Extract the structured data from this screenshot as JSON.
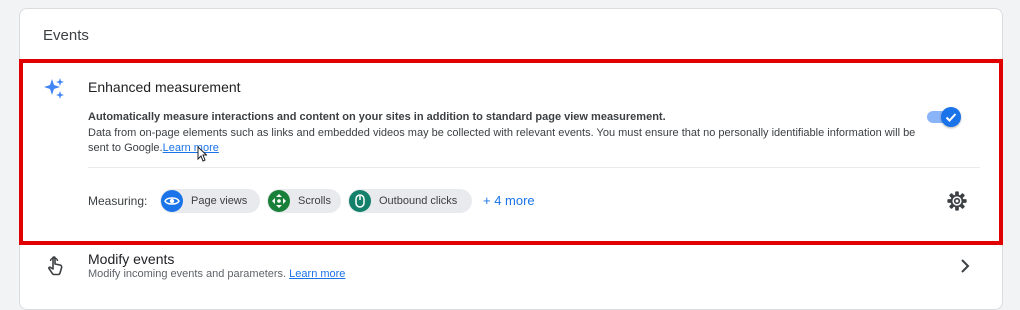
{
  "section": {
    "title": "Events"
  },
  "enhanced": {
    "title": "Enhanced measurement",
    "bold_desc": "Automatically measure interactions and content on your sites in addition to standard page view measurement.",
    "desc": "Data from on-page elements such as links and embedded videos may be collected with relevant events. You must ensure that no personally identifiable information will be sent to Google.",
    "learn_more": "Learn more",
    "toggle_on": true,
    "measuring_label": "Measuring:",
    "chips": [
      {
        "label": "Page views",
        "icon": "eye-icon",
        "color": "#1a73e8"
      },
      {
        "label": "Scrolls",
        "icon": "scroll-icon",
        "color": "#188038"
      },
      {
        "label": "Outbound clicks",
        "icon": "mouse-icon",
        "color": "#12806a"
      }
    ],
    "more": "+ 4 more",
    "settings_icon": "gear-icon"
  },
  "modify": {
    "title": "Modify events",
    "sub": "Modify incoming events and parameters.",
    "learn_more": "Learn more",
    "icon": "touch-icon",
    "chevron": "chevron-right-icon"
  },
  "colors": {
    "accent": "#1a73e8",
    "highlight_border": "#e00000"
  }
}
